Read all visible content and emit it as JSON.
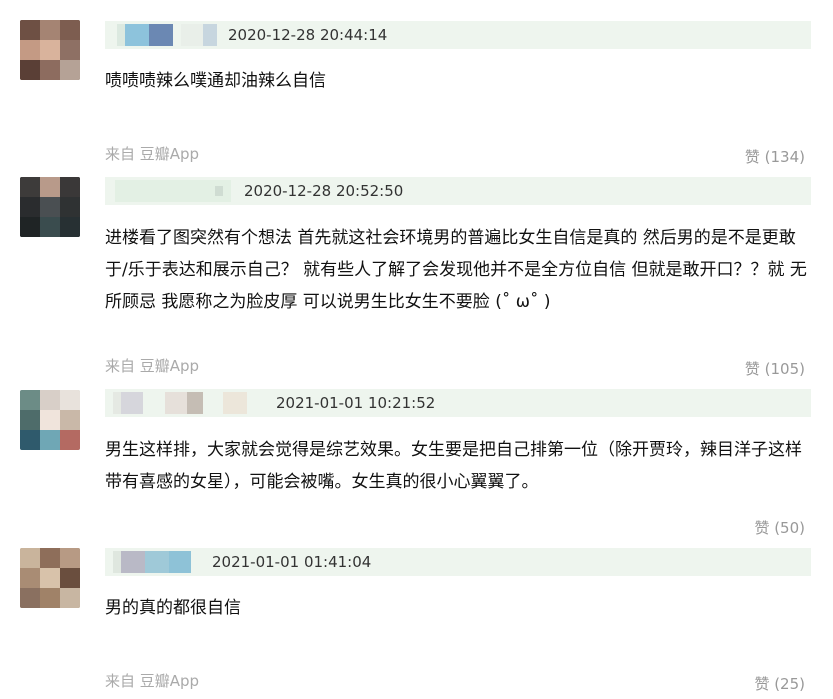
{
  "comments": [
    {
      "timestamp": "2020-12-28 20:44:14",
      "text": "啧啧啧辣么噗通却油辣么自信",
      "source": "来自 豆瓣App",
      "like_label": "赞 (134)"
    },
    {
      "timestamp": "2020-12-28 20:52:50",
      "text": "进楼看了图突然有个想法 首先就这社会环境男的普遍比女生自信是真的 然后男的是不是更敢于/乐于表达和展示自己？ 就有些人了解了会发现他并不是全方位自信 但就是敢开口？？就 无所顾忌 我愿称之为脸皮厚 可以说男生比女生不要脸 (˚ ω˚ )",
      "source": "来自 豆瓣App",
      "like_label": "赞 (105)"
    },
    {
      "timestamp": "2021-01-01 10:21:52",
      "text": "男生这样排，大家就会觉得是综艺效果。女生要是把自己排第一位（除开贾玲，辣目洋子这样带有喜感的女星），可能会被嘴。女生真的很小心翼翼了。",
      "like_label": "赞 (50)"
    },
    {
      "timestamp": "2021-01-01 01:41:04",
      "text": "男的真的都很自信",
      "source": "来自 豆瓣App",
      "like_label": "赞 (25)"
    }
  ],
  "colors": {
    "meta_bar": "#eef5ee",
    "source_text": "#aaaaaa",
    "like_text": "#999999"
  }
}
